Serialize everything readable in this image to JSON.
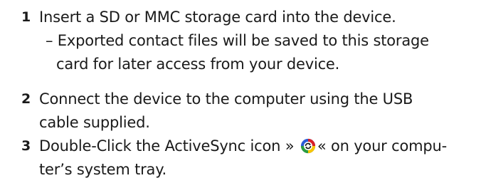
{
  "steps": [
    {
      "number": "1",
      "text": "Insert a SD or MMC storage card into the device.",
      "note_line1": "– Exported contact files will be saved to this storage",
      "note_line2": "card for later access from your device."
    },
    {
      "number": "2",
      "line1": "Connect the device to the computer using the USB",
      "line2": "cable supplied."
    },
    {
      "number": "3",
      "line1_before": "Double-Click the ActiveSync icon »",
      "line1_after": "« on your compu-",
      "line2": "ter’s system tray.",
      "icon": "activesync-icon",
      "icon_colors": [
        "#d81f26",
        "#f7c600",
        "#2a9d3f",
        "#2a5bd7"
      ]
    }
  ]
}
